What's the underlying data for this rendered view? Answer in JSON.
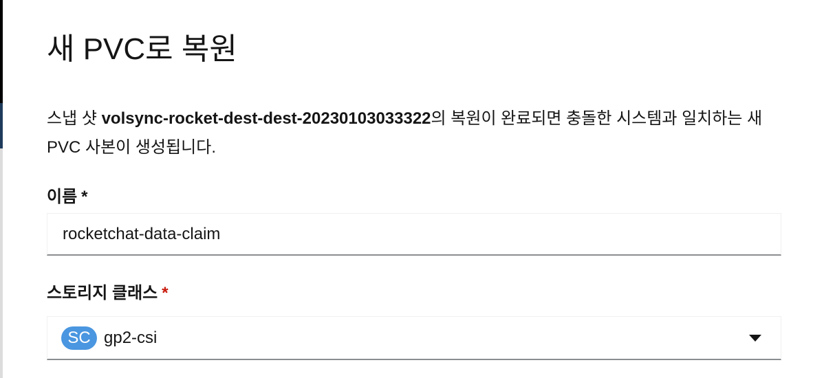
{
  "modal": {
    "title": "새 PVC로 복원",
    "description_prefix": "스냅 샷 ",
    "snapshot_name": "volsync-rocket-dest-dest-20230103033322",
    "description_suffix": "의 복원이 완료되면 충돌한 시스템과 일치하는 새 PVC 사본이 생성됩니다."
  },
  "form": {
    "name": {
      "label": "이름",
      "required_mark": "*",
      "value": "rocketchat-data-claim"
    },
    "storage_class": {
      "label": "스토리지 클래스",
      "required_mark": "*",
      "badge": "SC",
      "value": "gp2-csi",
      "badge_color": "#4a96e0",
      "required_color": "#c9190b"
    }
  }
}
